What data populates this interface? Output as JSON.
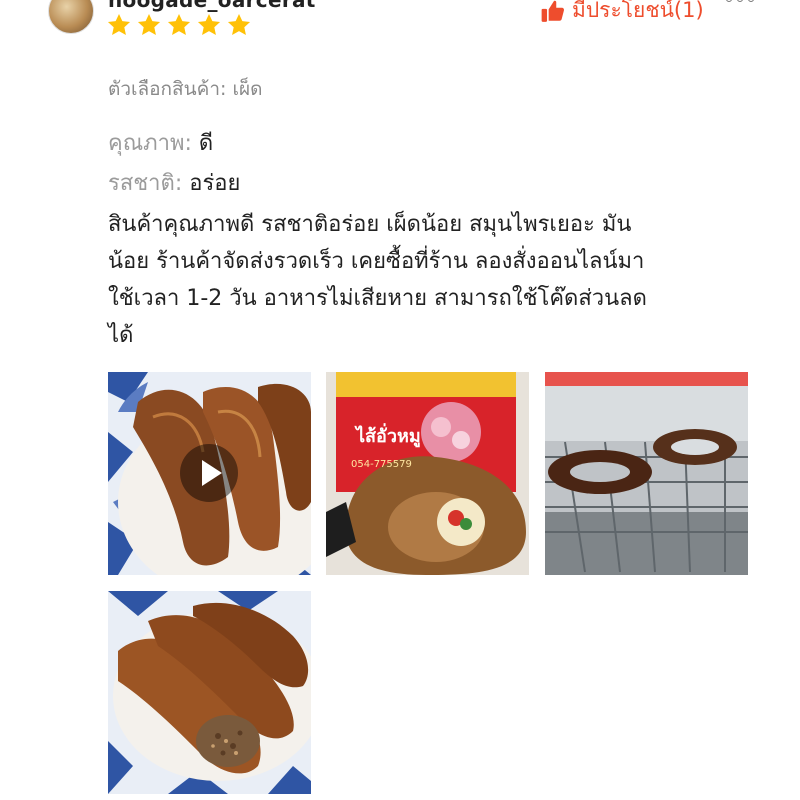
{
  "reviewer": {
    "username": "noogade_oarcerat",
    "rating": 5,
    "star_color": "#ffc107"
  },
  "actions": {
    "helpful_label": "มีประโยชน์(1)",
    "accent_color": "#ee4d2d",
    "more_icon": "more-dots-icon"
  },
  "variation": {
    "text": "ตัวเลือกสินค้า: เผ็ด"
  },
  "attributes": [
    {
      "label": "คุณภาพ: ",
      "value": "ดี"
    },
    {
      "label": "รสชาติ: ",
      "value": "อร่อย"
    }
  ],
  "review_lines": [
    "สินค้าคุณภาพดี รสชาติอร่อย  เผ็ดน้อย สมุนไพรเยอะ มัน",
    "น้อย ร้านค้าจัดส่งรวดเร็ว เคยซื้อที่ร้าน ลองสั่งออนไลน์มา",
    "ใช้เวลา 1-2 วัน อาหารไม่เสียหาย สามารถใช้โค๊ดส่วนลด",
    "ได้"
  ],
  "media": [
    {
      "type": "video",
      "description_icon": "play-icon"
    },
    {
      "type": "image"
    },
    {
      "type": "image"
    },
    {
      "type": "image"
    }
  ],
  "package_label": {
    "brand": "ไส้อั่วหมู",
    "phone": "054-775579"
  }
}
